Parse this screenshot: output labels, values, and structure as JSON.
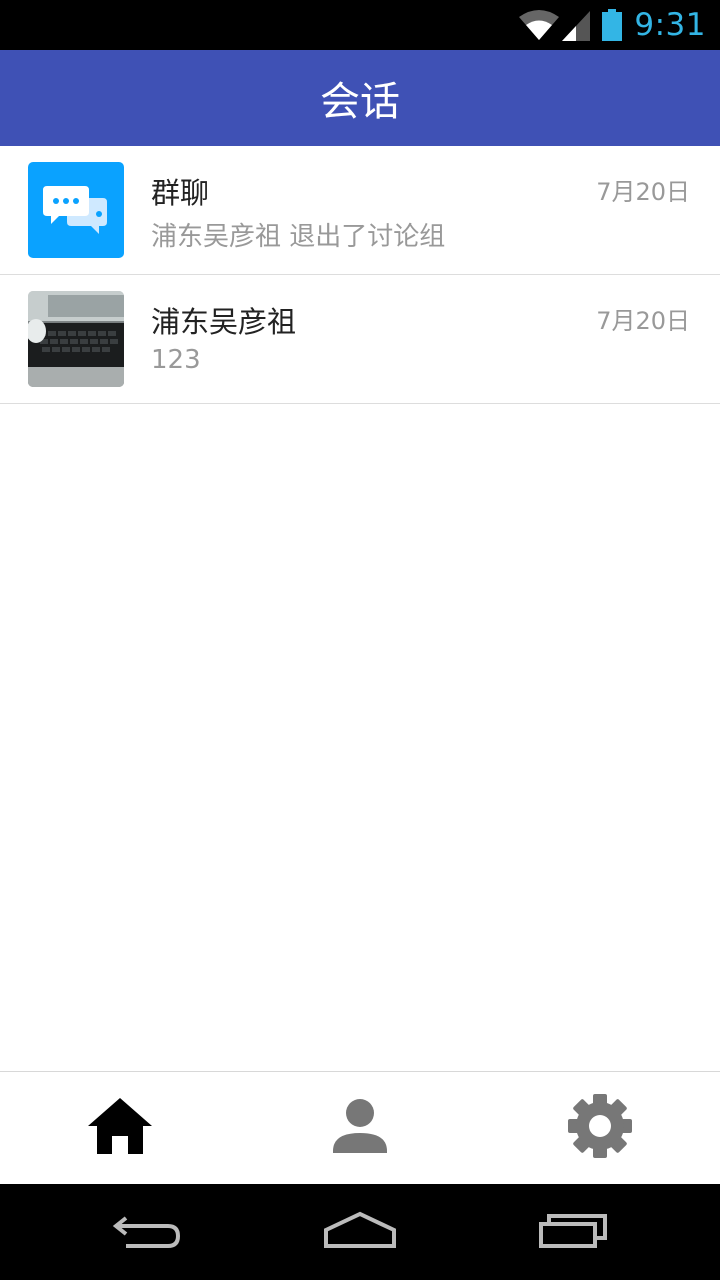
{
  "status_bar": {
    "time": "9:31",
    "icons": [
      "wifi-icon",
      "cell-signal-icon",
      "battery-icon"
    ],
    "accent_color": "#33b5e5"
  },
  "app_bar": {
    "title": "会话",
    "background_color": "#3f51b5"
  },
  "conversations": [
    {
      "name": "群聊",
      "preview": "浦东吴彦祖 退出了讨论组",
      "time": "7月20日",
      "avatar": "group-chat-icon"
    },
    {
      "name": "浦东吴彦祖",
      "preview": "123",
      "time": "7月20日",
      "avatar": "photo-avatar"
    }
  ],
  "bottom_nav": {
    "tabs": [
      {
        "icon": "home-icon",
        "selected": true
      },
      {
        "icon": "person-icon",
        "selected": false
      },
      {
        "icon": "gear-icon",
        "selected": false
      }
    ]
  },
  "system_nav": {
    "buttons": [
      "back-icon",
      "home-button-icon",
      "recent-apps-icon"
    ]
  }
}
